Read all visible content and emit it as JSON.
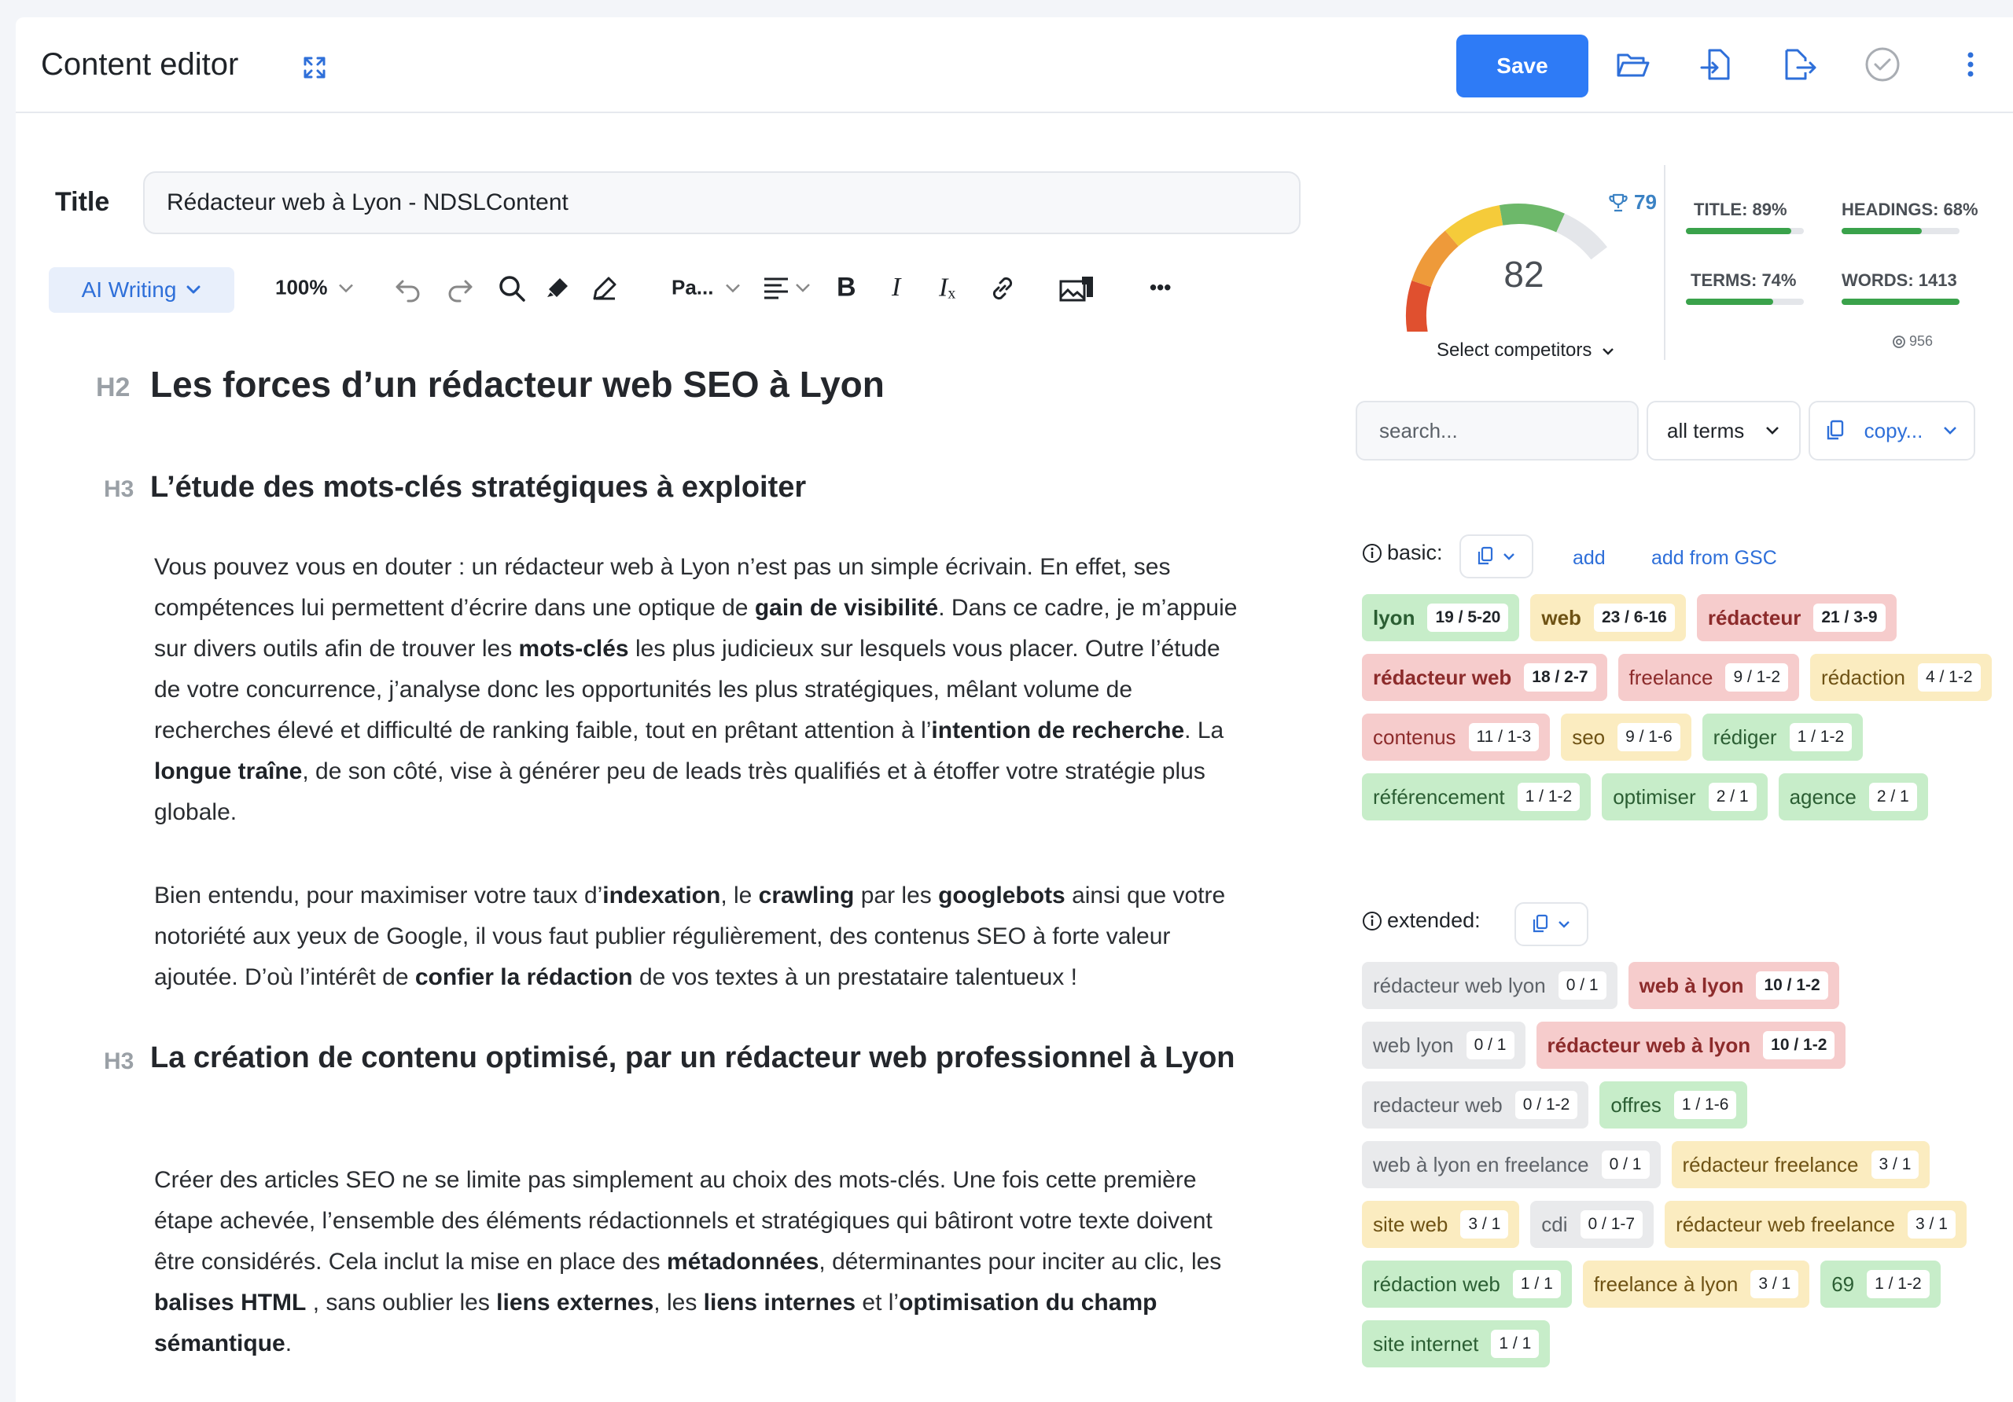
{
  "header": {
    "title": "Content editor",
    "save_label": "Save"
  },
  "title_field": {
    "label": "Title",
    "value": "Rédacteur web à Lyon - NDSLContent"
  },
  "toolbar": {
    "ai_writing": "AI Writing",
    "zoom": "100%",
    "paragraph": "Pa...",
    "more": "•••"
  },
  "content": {
    "h2_mark": "H2",
    "h2": "Les forces d’un rédacteur web SEO à Lyon",
    "h3_mark": "H3",
    "h3_1": "L’étude des mots-clés stratégiques à exploiter",
    "h3_2": "La création de contenu optimisé, par un rédacteur web professionnel à Lyon",
    "p1": [
      {
        "t": "Vous pouvez vous en douter : un rédacteur web à Lyon n’est pas un simple écrivain. En effet, ses compétences lui permettent d’écrire dans une optique de "
      },
      {
        "t": "gain de visibilité",
        "b": true
      },
      {
        "t": ". Dans ce cadre, je m’appuie sur divers outils afin de trouver les "
      },
      {
        "t": "mots-clés",
        "b": true
      },
      {
        "t": " les plus judicieux sur lesquels vous placer. Outre l’étude de votre concurrence, j’analyse donc les opportunités les plus stratégiques, mêlant volume de recherches élevé et difficulté de ranking faible, tout en prêtant attention à l’"
      },
      {
        "t": "intention de recherche",
        "b": true
      },
      {
        "t": ". La "
      },
      {
        "t": "longue traîne",
        "b": true
      },
      {
        "t": ", de son côté, vise à générer peu de leads très qualifiés et à étoffer votre stratégie plus globale."
      }
    ],
    "p2": [
      {
        "t": "Bien entendu, pour maximiser votre taux d’"
      },
      {
        "t": "indexation",
        "b": true
      },
      {
        "t": ", le "
      },
      {
        "t": "crawling",
        "b": true
      },
      {
        "t": " par les "
      },
      {
        "t": "googlebots",
        "b": true
      },
      {
        "t": " ainsi que votre notoriété aux yeux de Google, il vous faut publier régulièrement, des contenus SEO à forte valeur ajoutée. D’où l’intérêt de "
      },
      {
        "t": "confier la rédaction",
        "b": true
      },
      {
        "t": " de vos textes à un prestataire talentueux !"
      }
    ],
    "p3": [
      {
        "t": "Créer des articles SEO ne se limite pas simplement au choix des mots-clés. Une fois cette première étape achevée, l’ensemble des éléments rédactionnels et stratégiques qui bâtiront votre texte doivent être considérés. Cela inclut la mise en place des "
      },
      {
        "t": "métadonnées",
        "b": true
      },
      {
        "t": ", déterminantes pour inciter au clic, les "
      },
      {
        "t": "balises HTML",
        "b": true
      },
      {
        "t": " , sans oublier les "
      },
      {
        "t": "liens externes",
        "b": true
      },
      {
        "t": ", les "
      },
      {
        "t": "liens internes",
        "b": true
      },
      {
        "t": " et l’"
      },
      {
        "t": "optimisation du champ sémantique",
        "b": true
      },
      {
        "t": "."
      }
    ]
  },
  "score": {
    "value": "82",
    "gauge_fraction": 0.82,
    "competitor_score": "79",
    "select_competitors": "Select competitors"
  },
  "metrics": {
    "title": {
      "label": "TITLE: 89%",
      "fraction": 0.89
    },
    "headings": {
      "label": "HEADINGS: 68%",
      "fraction": 0.68
    },
    "terms": {
      "label": "TERMS: 74%",
      "fraction": 0.74
    },
    "words": {
      "label": "WORDS: 1413",
      "fraction": 1.0,
      "target": "956"
    }
  },
  "filters": {
    "search_placeholder": "search...",
    "terms_select": "all terms",
    "copy_select": "copy..."
  },
  "basic": {
    "label": "basic:",
    "add": "add",
    "add_gsc": "add from GSC",
    "chips": [
      {
        "term": "lyon",
        "count": "19 / 5-20",
        "color": "green",
        "bold": true
      },
      {
        "term": "web",
        "count": "23 / 6-16",
        "color": "yellow",
        "bold": true
      },
      {
        "term": "rédacteur",
        "count": "21 / 3-9",
        "color": "red",
        "bold": true
      },
      {
        "term": "rédacteur web",
        "count": "18 / 2-7",
        "color": "red",
        "bold": true
      },
      {
        "term": "freelance",
        "count": "9 / 1-2",
        "color": "red",
        "bold": false
      },
      {
        "term": "rédaction",
        "count": "4 / 1-2",
        "color": "yellow",
        "bold": false
      },
      {
        "term": "contenus",
        "count": "11 / 1-3",
        "color": "red",
        "bold": false
      },
      {
        "term": "seo",
        "count": "9 / 1-6",
        "color": "yellow",
        "bold": false
      },
      {
        "term": "rédiger",
        "count": "1 / 1-2",
        "color": "green",
        "bold": false
      },
      {
        "term": "référencement",
        "count": "1 / 1-2",
        "color": "green",
        "bold": false
      },
      {
        "term": "optimiser",
        "count": "2 / 1",
        "color": "green",
        "bold": false
      },
      {
        "term": "agence",
        "count": "2 / 1",
        "color": "green",
        "bold": false
      }
    ]
  },
  "extended": {
    "label": "extended:",
    "chips": [
      {
        "term": "rédacteur web lyon",
        "count": "0 / 1",
        "color": "gray",
        "bold": false
      },
      {
        "term": "web à lyon",
        "count": "10 / 1-2",
        "color": "red",
        "bold": true
      },
      {
        "term": "web lyon",
        "count": "0 / 1",
        "color": "gray",
        "bold": false
      },
      {
        "term": "rédacteur web à lyon",
        "count": "10 / 1-2",
        "color": "red",
        "bold": true
      },
      {
        "term": "redacteur web",
        "count": "0 / 1-2",
        "color": "gray",
        "bold": false
      },
      {
        "term": "offres",
        "count": "1 / 1-6",
        "color": "green",
        "bold": false
      },
      {
        "term": "web à lyon en freelance",
        "count": "0 / 1",
        "color": "gray",
        "bold": false
      },
      {
        "term": "rédacteur freelance",
        "count": "3 / 1",
        "color": "yellow",
        "bold": false
      },
      {
        "term": "site web",
        "count": "3 / 1",
        "color": "yellow",
        "bold": false
      },
      {
        "term": "cdi",
        "count": "0 / 1-7",
        "color": "gray",
        "bold": false
      },
      {
        "term": "rédacteur web freelance",
        "count": "3 / 1",
        "color": "yellow",
        "bold": false
      },
      {
        "term": "rédaction web",
        "count": "1 / 1",
        "color": "green",
        "bold": false
      },
      {
        "term": "freelance à lyon",
        "count": "3 / 1",
        "color": "yellow",
        "bold": false
      },
      {
        "term": "69",
        "count": "1 / 1-2",
        "color": "green",
        "bold": false
      },
      {
        "term": "site internet",
        "count": "1 / 1",
        "color": "green",
        "bold": false
      }
    ]
  },
  "colors": {
    "accent": "#2e7bf6",
    "good": "#3aa24b",
    "gauge_red": "#e0502f",
    "gauge_orange": "#ee9a3a",
    "gauge_yellow": "#f5cb3a",
    "gauge_green": "#6db86a"
  }
}
